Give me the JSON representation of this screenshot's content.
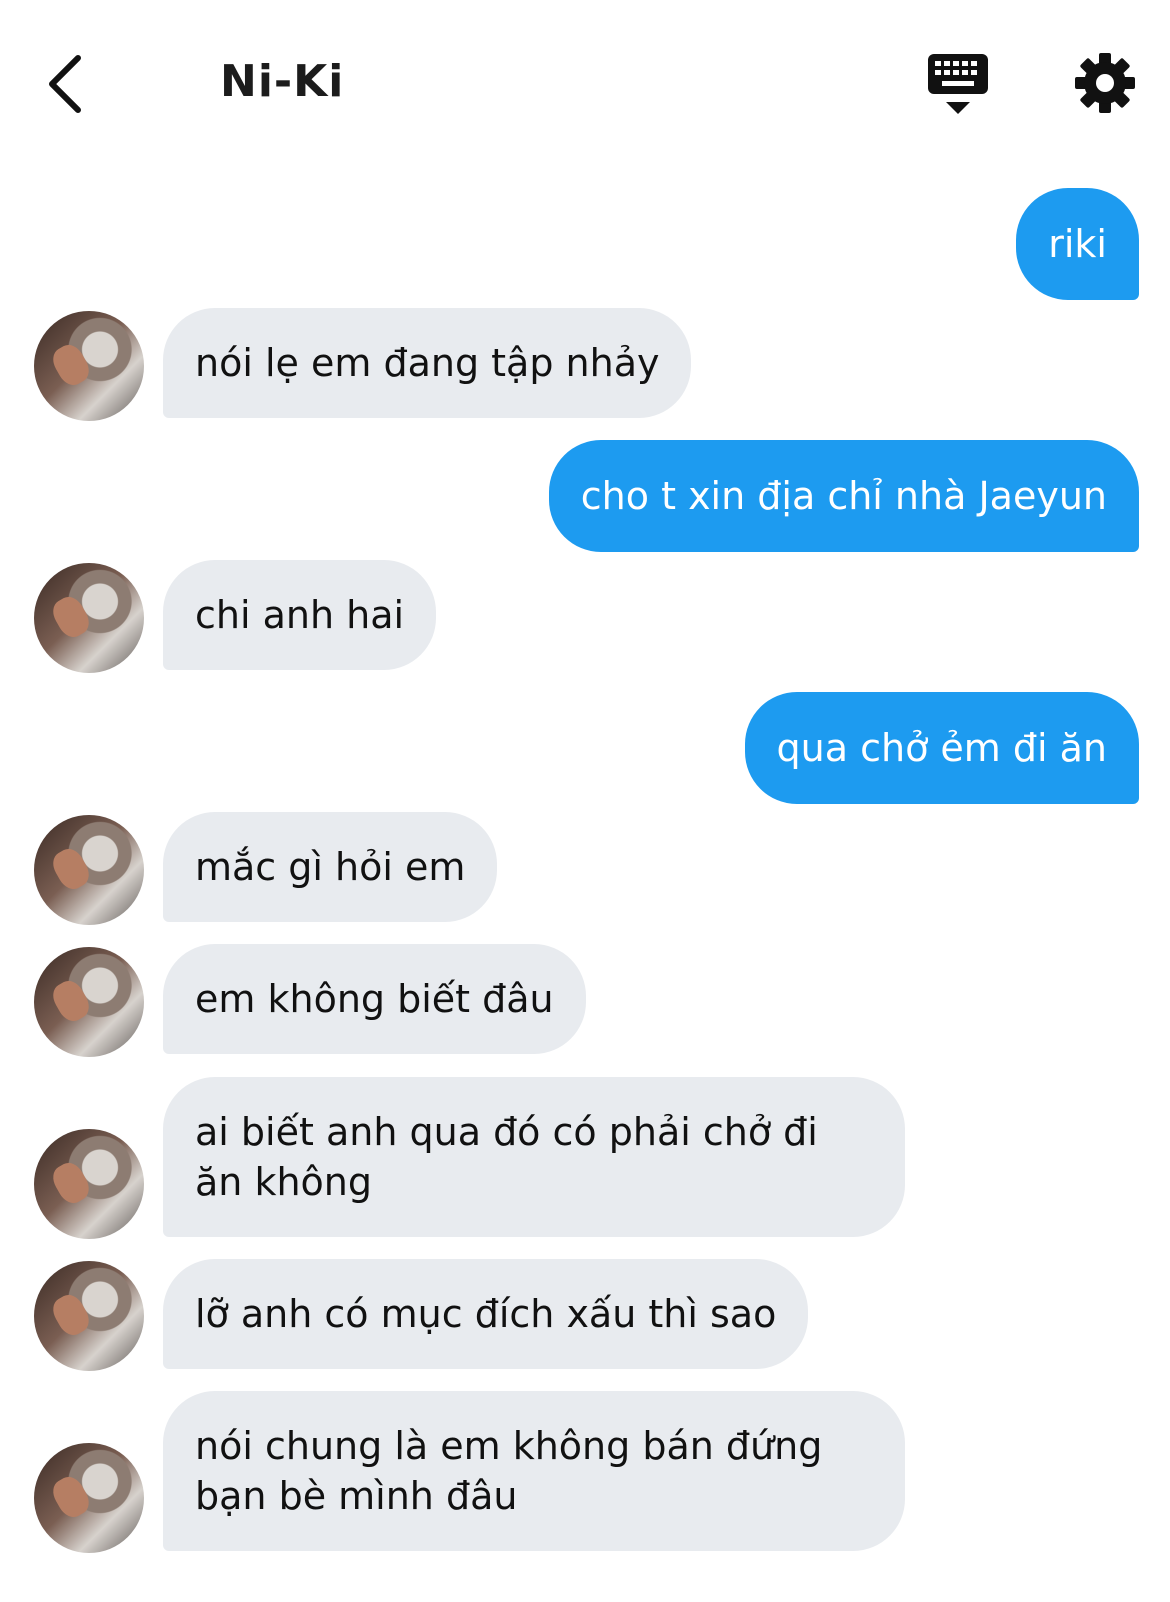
{
  "header": {
    "title": "Ni-Ki"
  },
  "messages": [
    {
      "side": "out",
      "text": "riki"
    },
    {
      "side": "in",
      "text": "nói lẹ em đang tập nhảy"
    },
    {
      "side": "out",
      "text": "cho t xin địa chỉ nhà Jaeyun"
    },
    {
      "side": "in",
      "text": "chi anh hai"
    },
    {
      "side": "out",
      "text": "qua chở ẻm đi ăn"
    },
    {
      "side": "in",
      "text": "mắc gì hỏi em"
    },
    {
      "side": "in",
      "text": "em không biết đâu"
    },
    {
      "side": "in",
      "text": "ai biết anh qua đó có phải chở đi ăn không"
    },
    {
      "side": "in",
      "text": "lỡ anh có mục đích xấu thì sao"
    },
    {
      "side": "in",
      "text": "nói chung là em không bán đứng bạn bè mình đâu"
    }
  ],
  "colors": {
    "outgoing_bubble": "#1d9bf0",
    "incoming_bubble": "#e8ebef"
  },
  "icons": {
    "back": "chevron-left-icon",
    "keyboard": "keyboard-hide-icon",
    "settings": "gear-icon"
  }
}
